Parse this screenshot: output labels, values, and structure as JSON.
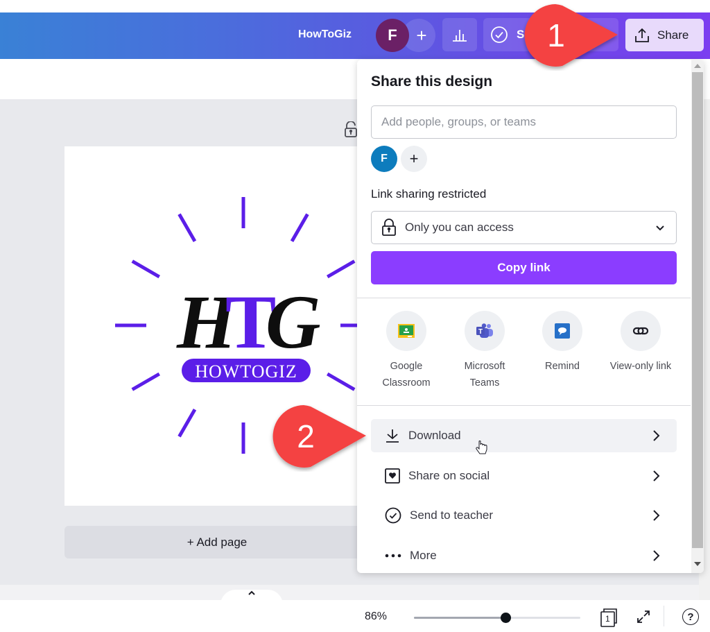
{
  "header": {
    "title": "HowToGiz",
    "avatar_initial": "F",
    "add_label": "+",
    "stats_icon": "bar-chart-icon",
    "submit_label_partial": "S",
    "share_label": "Share",
    "share_icon": "share-upload-icon"
  },
  "canvas": {
    "logo_letters": [
      "H",
      "T",
      "G"
    ],
    "logo_badge": "HOWTOGIZ",
    "lock_icon": "unlocked-padlock-icon",
    "add_page_label": "+ Add page",
    "accent_color": "#5b1ee8"
  },
  "share_panel": {
    "title": "Share this design",
    "people_input_placeholder": "Add people, groups, or teams",
    "people_input_value": "",
    "collaborator_initial": "F",
    "add_collaborator_label": "+",
    "link_sharing_label": "Link sharing restricted",
    "access_selected": "Only you can access",
    "copy_link_label": "Copy link",
    "copy_link_color": "#8b3dff",
    "apps": [
      {
        "label_line1": "Google",
        "label_line2": "Classroom",
        "icon": "google-classroom-icon"
      },
      {
        "label_line1": "Microsoft",
        "label_line2": "Teams",
        "icon": "microsoft-teams-icon"
      },
      {
        "label_line1": "Remind",
        "label_line2": "",
        "icon": "remind-icon"
      },
      {
        "label_line1": "View-only link",
        "label_line2": "",
        "icon": "link-icon"
      }
    ],
    "menu": [
      {
        "label": "Download",
        "icon": "download-icon",
        "hovered": true
      },
      {
        "label": "Share on social",
        "icon": "heart-square-icon",
        "hovered": false
      },
      {
        "label": "Send to teacher",
        "icon": "check-circle-icon",
        "hovered": false
      },
      {
        "label": "More",
        "icon": "more-dots-icon",
        "hovered": false
      }
    ]
  },
  "footer": {
    "zoom_label": "86%",
    "zoom_fraction": 0.55,
    "page_count": "1",
    "help_label": "?"
  },
  "callouts": [
    {
      "number": "1",
      "color": "#f44242",
      "target": "share-button"
    },
    {
      "number": "2",
      "color": "#f44242",
      "target": "download-menu-item"
    }
  ]
}
